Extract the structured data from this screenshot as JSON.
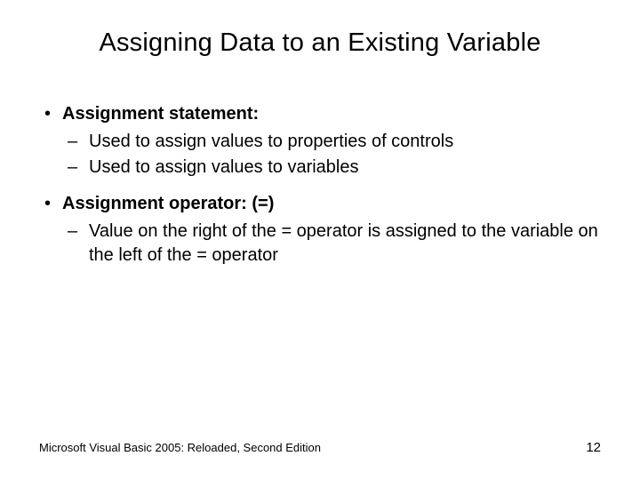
{
  "title": "Assigning Data to an Existing Variable",
  "bullets": {
    "b1": {
      "label": "Assignment statement:"
    },
    "b1_sub": {
      "s1": "Used to assign values to properties of controls",
      "s2": "Used to assign values to variables"
    },
    "b2": {
      "label": "Assignment operator: (=)"
    },
    "b2_sub": {
      "s1": "Value on the right of the = operator is assigned to the variable on the left of the = operator"
    }
  },
  "footer": {
    "left": "Microsoft Visual Basic 2005: Reloaded, Second Edition",
    "page": "12"
  }
}
